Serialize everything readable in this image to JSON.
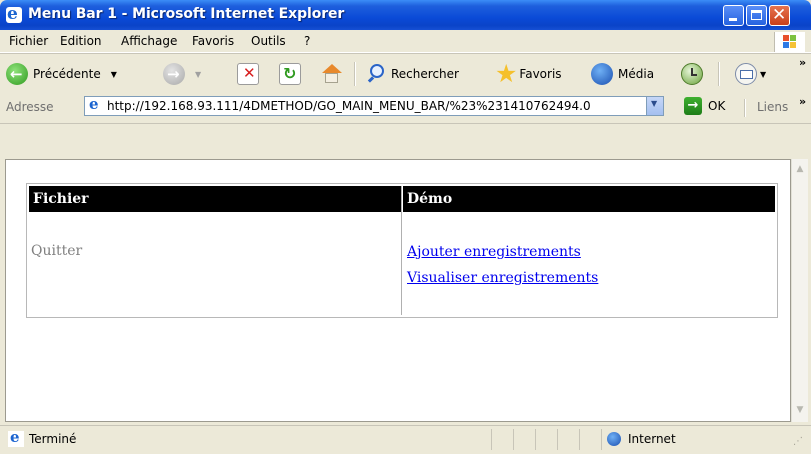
{
  "window": {
    "title": "Menu Bar 1 - Microsoft Internet Explorer",
    "accent_color": "#0a4ad7",
    "close_color": "#c93f1a"
  },
  "menubar": {
    "items": [
      "Fichier",
      "Edition",
      "Affichage",
      "Favoris",
      "Outils",
      "?"
    ]
  },
  "toolbar": {
    "back_label": "Précédente",
    "search_label": "Rechercher",
    "favorites_label": "Favoris",
    "media_label": "Média"
  },
  "addressbar": {
    "label": "Adresse",
    "url": "http://192.168.93.111/4DMETHOD/GO_MAIN_MENU_BAR/%23%231410762494.0",
    "go_label": "OK",
    "links_label": "Liens"
  },
  "page": {
    "columns": [
      {
        "header": "Fichier",
        "items": [
          {
            "label": "Quitter",
            "link": false
          }
        ]
      },
      {
        "header": "Démo",
        "items": [
          {
            "label": "Ajouter enregistrements",
            "link": true
          },
          {
            "label": "Visualiser enregistrements",
            "link": true
          }
        ]
      }
    ]
  },
  "statusbar": {
    "status": "Terminé",
    "zone": "Internet"
  }
}
